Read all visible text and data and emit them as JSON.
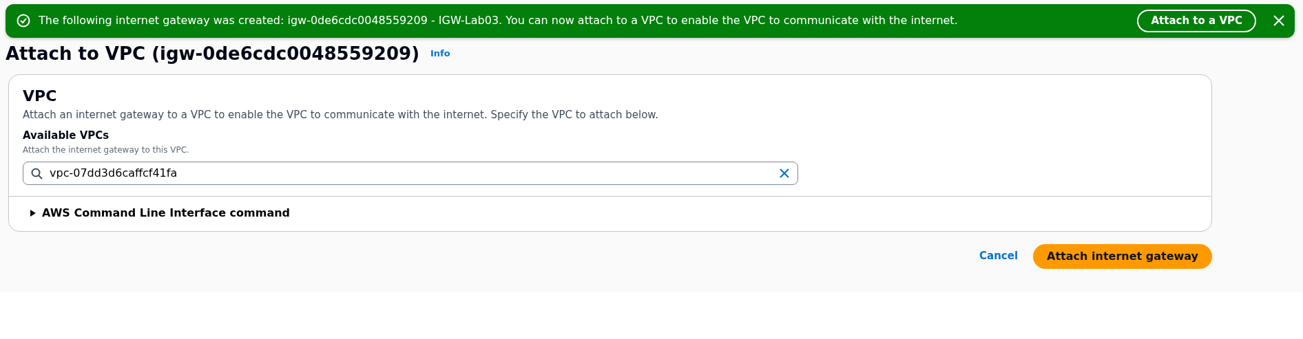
{
  "flash": {
    "kind": "success",
    "message": "The following internet gateway was created: igw-0de6cdc0048559209 - IGW-Lab03. You can now attach to a VPC to enable the VPC to communicate with the internet.",
    "action": "Attach to a VPC"
  },
  "page": {
    "title": "Attach to VPC (igw-0de6cdc0048559209)",
    "info": "Info"
  },
  "container": {
    "title": "VPC",
    "description": "Attach an internet gateway to a VPC to enable the VPC to communicate with the internet. Specify the VPC to attach below.",
    "field": {
      "label": "Available VPCs",
      "hint": "Attach the internet gateway to this VPC.",
      "value": "vpc-07dd3d6caffcf41fa"
    },
    "expander": {
      "label": "AWS Command Line Interface command",
      "expanded": false
    }
  },
  "actions": [
    "Cancel",
    "Attach internet gateway"
  ]
}
